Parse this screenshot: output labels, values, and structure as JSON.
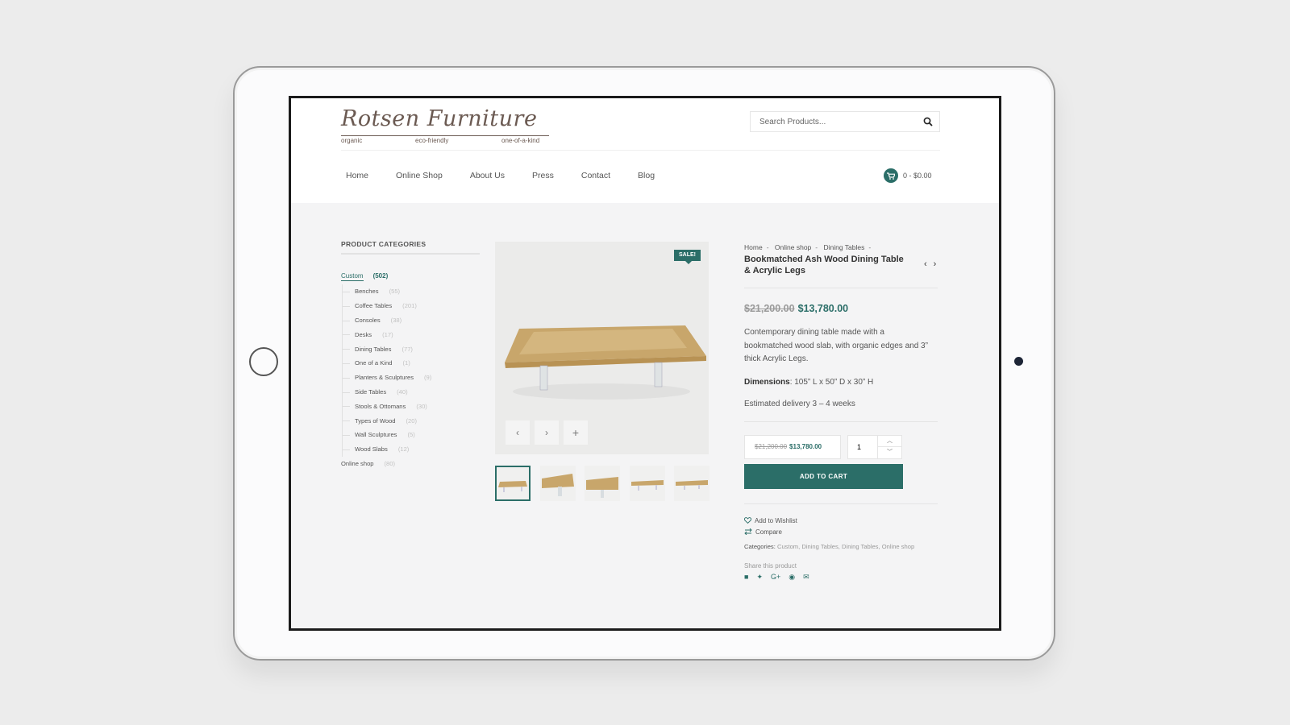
{
  "brand": {
    "name": "Rotsen Furniture",
    "tags": [
      "organic",
      "eco-friendly",
      "one-of-a-kind"
    ]
  },
  "search": {
    "placeholder": "Search Products..."
  },
  "nav": [
    "Home",
    "Online Shop",
    "About Us",
    "Press",
    "Contact",
    "Blog"
  ],
  "cart": {
    "summary": "0 - $0.00"
  },
  "sidebar": {
    "title": "PRODUCT CATEGORIES",
    "custom": {
      "label": "Custom",
      "count": "(502)"
    },
    "subcategories": [
      {
        "label": "Benches",
        "count": "(55)"
      },
      {
        "label": "Coffee Tables",
        "count": "(201)"
      },
      {
        "label": "Consoles",
        "count": "(38)"
      },
      {
        "label": "Desks",
        "count": "(17)"
      },
      {
        "label": "Dining Tables",
        "count": "(77)"
      },
      {
        "label": "One of a Kind",
        "count": "(1)"
      },
      {
        "label": "Planters & Sculptures",
        "count": "(9)"
      },
      {
        "label": "Side Tables",
        "count": "(40)"
      },
      {
        "label": "Stools & Ottomans",
        "count": "(30)"
      },
      {
        "label": "Types of Wood",
        "count": "(20)"
      },
      {
        "label": "Wall Sculptures",
        "count": "(5)"
      },
      {
        "label": "Wood Slabs",
        "count": "(12)"
      }
    ],
    "online_shop": {
      "label": "Online shop",
      "count": "(80)"
    }
  },
  "gallery": {
    "badge": "SALE!",
    "prev": "‹",
    "next": "›",
    "zoom": "+"
  },
  "product": {
    "breadcrumb": [
      "Home",
      "Online shop",
      "Dining Tables"
    ],
    "title": "Bookmatched Ash Wood Dining Table & Acrylic Legs",
    "old_price": "$21,200.00",
    "new_price": "$13,780.00",
    "description": "Contemporary dining table made with a bookmatched wood slab, with organic edges and 3” thick Acrylic Legs.",
    "dimensions_label": "Dimensions",
    "dimensions_value": ": 105” L x 50” D x 30” H",
    "delivery": "Estimated delivery 3 – 4 weeks",
    "quantity": "1",
    "add_to_cart": "ADD TO CART",
    "wishlist": "Add to Wishlist",
    "compare": "Compare",
    "categories_label": "Categories:",
    "categories_links": "Custom, Dining Tables, Dining Tables, Online shop",
    "share_label": "Share this product"
  },
  "colors": {
    "accent": "#2b6e68",
    "logo": "#6b5a52"
  }
}
